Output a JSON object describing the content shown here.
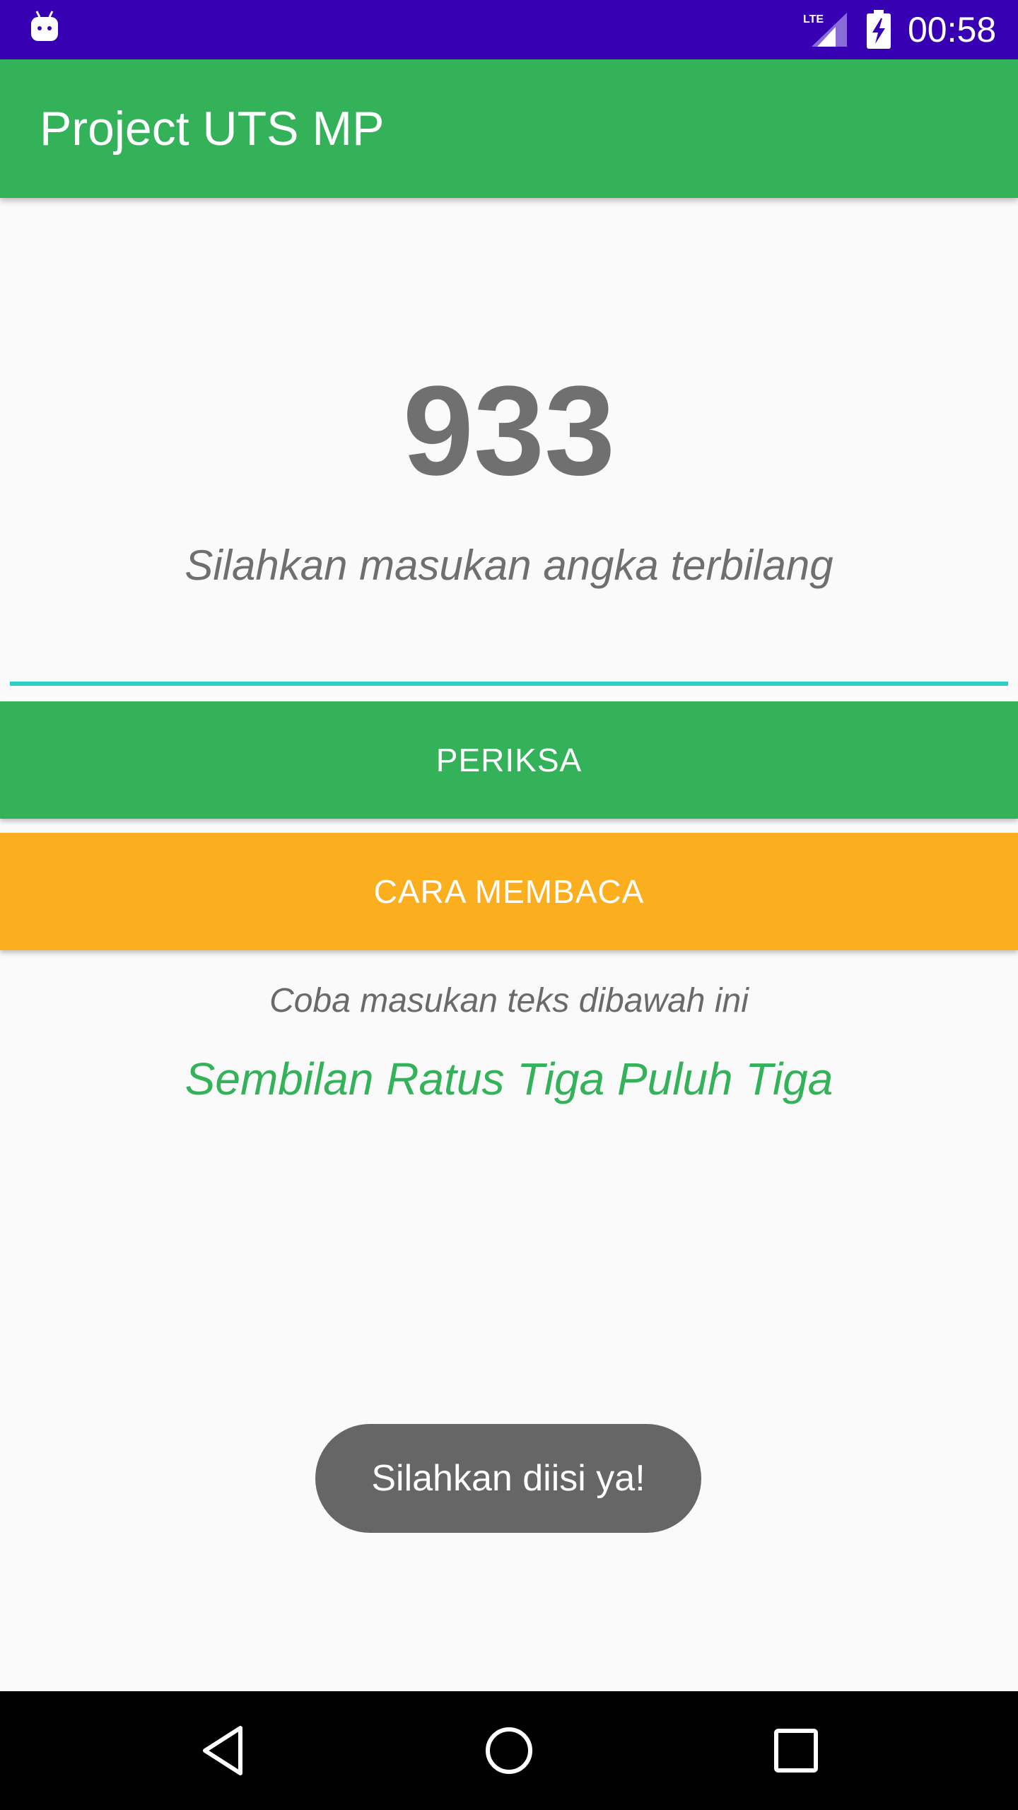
{
  "status_bar": {
    "clock": "00:58",
    "network_label": "LTE",
    "background_color": "#3700b3",
    "icons": [
      "android-icon",
      "lte-signal-icon",
      "battery-charging-icon"
    ]
  },
  "app_bar": {
    "title": "Project UTS MP",
    "color": "#34b25a"
  },
  "main": {
    "number": "933",
    "prompt": "Silahkan masukan angka terbilang",
    "input": {
      "value": "",
      "placeholder": ""
    },
    "check_button": {
      "label": "PERIKSA",
      "color": "#34b25a"
    },
    "how_to_read_button": {
      "label": "CARA MEMBACA",
      "color": "#fbae1e"
    },
    "hint": "Coba masukan teks dibawah ini",
    "answer": "Sembilan Ratus Tiga Puluh Tiga"
  },
  "toast": {
    "message": "Silahkan diisi ya!"
  },
  "nav_bar": {
    "icons": [
      "back-icon",
      "home-icon",
      "recents-icon"
    ]
  }
}
